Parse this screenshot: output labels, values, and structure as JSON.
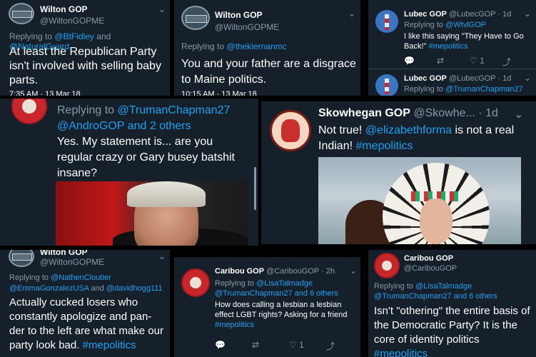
{
  "tiles": {
    "wilton1": {
      "name": "Wilton GOP",
      "handle": "@WiltonGOPME",
      "replying_prefix": "Replying to",
      "reply_to_a": "@BtFidley",
      "reply_and": "and",
      "reply_to_b": "@NaturalGuard",
      "text": "At least the Republican Party isn't involved with selling baby parts.",
      "timestamp": "7:35 AM · 13 Mar 18"
    },
    "wilton2": {
      "name": "Wilton GOP",
      "handle": "@WiltonGOPME",
      "replying_prefix": "Replying to",
      "reply_to": "@thekiernanmc",
      "text": "You and your father are a disgrace to Maine politics.",
      "timestamp": "10:15 AM · 13 Mar 18"
    },
    "lubec": {
      "tweet1": {
        "name": "Lubec GOP",
        "handle": "@LubecGOP · 1d",
        "replying_prefix": "Replying to",
        "reply_to": "@WtvlGOP",
        "text": "I like this saying \"They Have to Go Back!\"",
        "hashtag": "#mepolitics",
        "like_count": "1"
      },
      "tweet2": {
        "name": "Lubec GOP",
        "handle": "@LubecGOP · 1d",
        "replying_prefix": "Replying to",
        "reply_to": "@TrumanChapman27"
      }
    },
    "reply_big": {
      "replying_prefix": "Replying to",
      "reply_to_a": "@TrumanChapman27",
      "reply_to_b": "@AndroGOP",
      "reply_more": "and 2 others",
      "text": "Yes. My statement is... are you regular crazy or Gary busey batshit insane?"
    },
    "skowhegan": {
      "name": "Skowhegan GOP",
      "handle": "@Skowhe... · 1d",
      "text_a": "Not true!",
      "mention": "@elizabethforma",
      "text_b": "is not a real Indian!",
      "hashtag": "#mepolitics"
    },
    "wilton3": {
      "name": "Wilton GOP",
      "handle": "@WiltonGOPME",
      "replying_prefix": "Replying to",
      "reply_to_a": "@NathenCloutier",
      "reply_to_b": "@EmmaGonzalezUSA",
      "reply_and": "and",
      "reply_to_c": "@davidhogg111",
      "text": "Actually cucked losers who constantly apologize and pan- der to the left are what make our party look bad.",
      "hashtag": "#mepolitics"
    },
    "caribou1": {
      "name": "Caribou GOP",
      "handle": "@CaribouGOP · 2h",
      "replying_prefix": "Replying to",
      "reply_to_a": "@LisaTalmadge",
      "reply_to_b": "@TrumanChapman27",
      "reply_more": "and 6 others",
      "text": "How does calling a lesbian a lesbian effect LGBT rights? Asking for a friend",
      "hashtag": "#mepolitics",
      "like_count": "1"
    },
    "caribou2": {
      "name": "Caribou GOP",
      "handle": "@CaribouGOP",
      "replying_prefix": "Replying to",
      "reply_to_a": "@LisaTalmadge",
      "reply_to_b": "@TrumanChapman27",
      "reply_more": "and 6 others",
      "text": "Isn't \"othering\" the entire basis of the Democratic Party? It is the core of identity politics",
      "hashtag": "#mepolitics"
    }
  },
  "icons": {
    "reply": "💬",
    "retweet": "⇄",
    "like": "♡",
    "share": "⤴",
    "chevron": "⌄"
  },
  "colors": {
    "background": "#15202b",
    "link": "#1da1f2",
    "muted": "#8899a6"
  }
}
